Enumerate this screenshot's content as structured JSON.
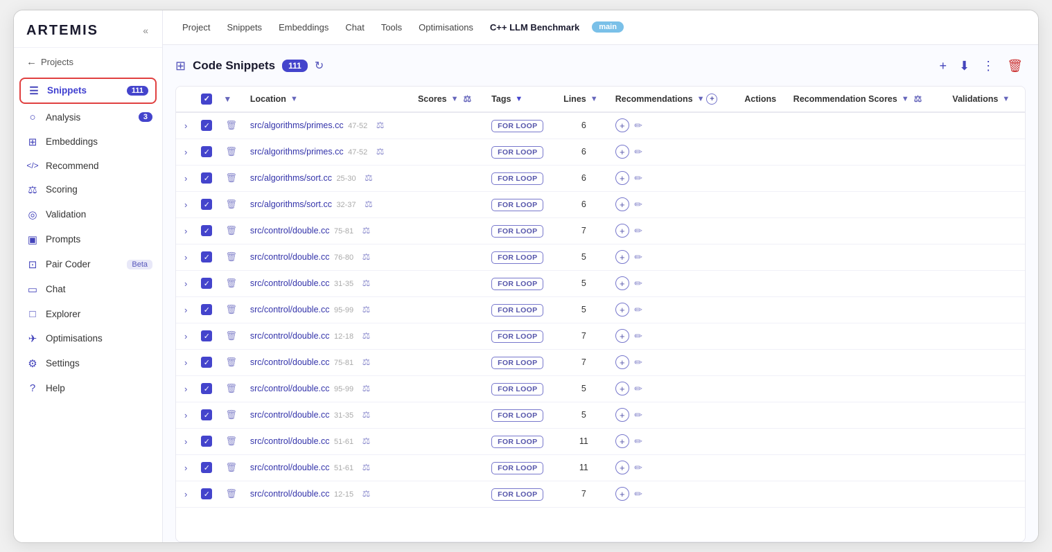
{
  "app": {
    "logo": "ARTEMIS",
    "collapse_label": "«"
  },
  "back": {
    "label": "Projects"
  },
  "sidebar": {
    "items": [
      {
        "id": "snippets",
        "icon": "☰",
        "label": "Snippets",
        "badge": "111",
        "active": true
      },
      {
        "id": "analysis",
        "icon": "○",
        "label": "Analysis",
        "badge": "3"
      },
      {
        "id": "embeddings",
        "icon": "⊞",
        "label": "Embeddings",
        "badge": null
      },
      {
        "id": "recommend",
        "icon": "</>",
        "label": "Recommend",
        "badge": null
      },
      {
        "id": "scoring",
        "icon": "⚖",
        "label": "Scoring",
        "badge": null
      },
      {
        "id": "validation",
        "icon": "◎",
        "label": "Validation",
        "badge": null
      },
      {
        "id": "prompts",
        "icon": "▣",
        "label": "Prompts",
        "badge": null
      },
      {
        "id": "pair-coder",
        "icon": "⊡",
        "label": "Pair Coder",
        "beta": true
      },
      {
        "id": "chat",
        "icon": "▭",
        "label": "Chat",
        "badge": null
      },
      {
        "id": "explorer",
        "icon": "□",
        "label": "Explorer",
        "badge": null
      },
      {
        "id": "optimisations",
        "icon": "✈",
        "label": "Optimisations",
        "badge": null
      },
      {
        "id": "settings",
        "icon": "⚙",
        "label": "Settings",
        "badge": null
      },
      {
        "id": "help",
        "icon": "?",
        "label": "Help",
        "badge": null
      }
    ]
  },
  "topnav": {
    "items": [
      {
        "id": "project",
        "label": "Project"
      },
      {
        "id": "snippets",
        "label": "Snippets"
      },
      {
        "id": "embeddings",
        "label": "Embeddings"
      },
      {
        "id": "chat",
        "label": "Chat"
      },
      {
        "id": "tools",
        "label": "Tools"
      },
      {
        "id": "optimisations",
        "label": "Optimisations"
      },
      {
        "id": "benchmark",
        "label": "C++ LLM Benchmark",
        "active": true
      }
    ],
    "branch": "main"
  },
  "content": {
    "title": "Code Snippets",
    "count": "111",
    "buttons": {
      "add": "+",
      "download": "↓",
      "more": "⋮",
      "delete": "🗑"
    }
  },
  "table": {
    "columns": [
      {
        "id": "expand",
        "label": ""
      },
      {
        "id": "check",
        "label": "✓"
      },
      {
        "id": "filter",
        "label": "▼"
      },
      {
        "id": "location",
        "label": "Location",
        "filter": true
      },
      {
        "id": "scores",
        "label": "Scores",
        "filter": true,
        "compare": true
      },
      {
        "id": "tags",
        "label": "Tags",
        "filter": true
      },
      {
        "id": "lines",
        "label": "Lines",
        "filter": true
      },
      {
        "id": "recommendations",
        "label": "Recommendations",
        "filter": true,
        "add": true
      },
      {
        "id": "actions",
        "label": "Actions"
      },
      {
        "id": "rec-scores",
        "label": "Recommendation Scores",
        "filter": true,
        "compare": true
      },
      {
        "id": "validations",
        "label": "Validations",
        "filter": true
      }
    ],
    "rows": [
      {
        "location": "src/algorithms/primes.cc",
        "range": "47-52",
        "tag": "FOR LOOP",
        "lines": "6"
      },
      {
        "location": "src/algorithms/primes.cc",
        "range": "47-52",
        "tag": "FOR LOOP",
        "lines": "6"
      },
      {
        "location": "src/algorithms/sort.cc",
        "range": "25-30",
        "tag": "FOR LOOP",
        "lines": "6"
      },
      {
        "location": "src/algorithms/sort.cc",
        "range": "32-37",
        "tag": "FOR LOOP",
        "lines": "6"
      },
      {
        "location": "src/control/double.cc",
        "range": "75-81",
        "tag": "FOR LOOP",
        "lines": "7"
      },
      {
        "location": "src/control/double.cc",
        "range": "76-80",
        "tag": "FOR LOOP",
        "lines": "5"
      },
      {
        "location": "src/control/double.cc",
        "range": "31-35",
        "tag": "FOR LOOP",
        "lines": "5"
      },
      {
        "location": "src/control/double.cc",
        "range": "95-99",
        "tag": "FOR LOOP",
        "lines": "5"
      },
      {
        "location": "src/control/double.cc",
        "range": "12-18",
        "tag": "FOR LOOP",
        "lines": "7"
      },
      {
        "location": "src/control/double.cc",
        "range": "75-81",
        "tag": "FOR LOOP",
        "lines": "7"
      },
      {
        "location": "src/control/double.cc",
        "range": "95-99",
        "tag": "FOR LOOP",
        "lines": "5"
      },
      {
        "location": "src/control/double.cc",
        "range": "31-35",
        "tag": "FOR LOOP",
        "lines": "5"
      },
      {
        "location": "src/control/double.cc",
        "range": "51-61",
        "tag": "FOR LOOP",
        "lines": "11"
      },
      {
        "location": "src/control/double.cc",
        "range": "51-61",
        "tag": "FOR LOOP",
        "lines": "11"
      },
      {
        "location": "src/control/double.cc",
        "range": "12-15",
        "tag": "FOR LOOP",
        "lines": "7"
      }
    ]
  }
}
